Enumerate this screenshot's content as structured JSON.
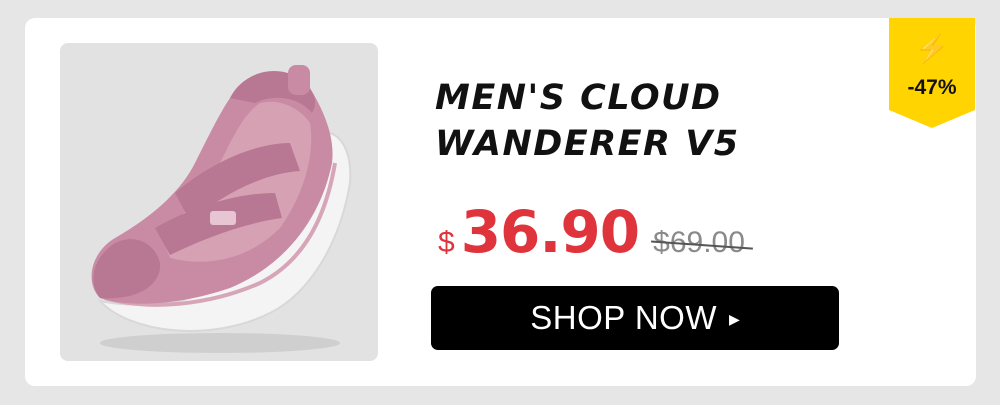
{
  "product": {
    "title": "MEN'S CLOUD WANDERER V5",
    "image_alt": "pink velcro sneaker"
  },
  "pricing": {
    "currency_symbol": "$",
    "sale_price": "36.90",
    "original_price": "$69.00"
  },
  "cta": {
    "label": "SHOP NOW",
    "icon": "play-triangle-icon"
  },
  "badge": {
    "icon": "lightning-bolt-icon",
    "discount": "-47%"
  },
  "colors": {
    "page_background": "#e6e6e6",
    "card_background": "#ffffff",
    "image_background": "#e2e2e2",
    "price_red": "#e0343d",
    "badge_yellow": "#ffd400",
    "button_black": "#000000",
    "shoe_pink": "#c98aa3"
  }
}
